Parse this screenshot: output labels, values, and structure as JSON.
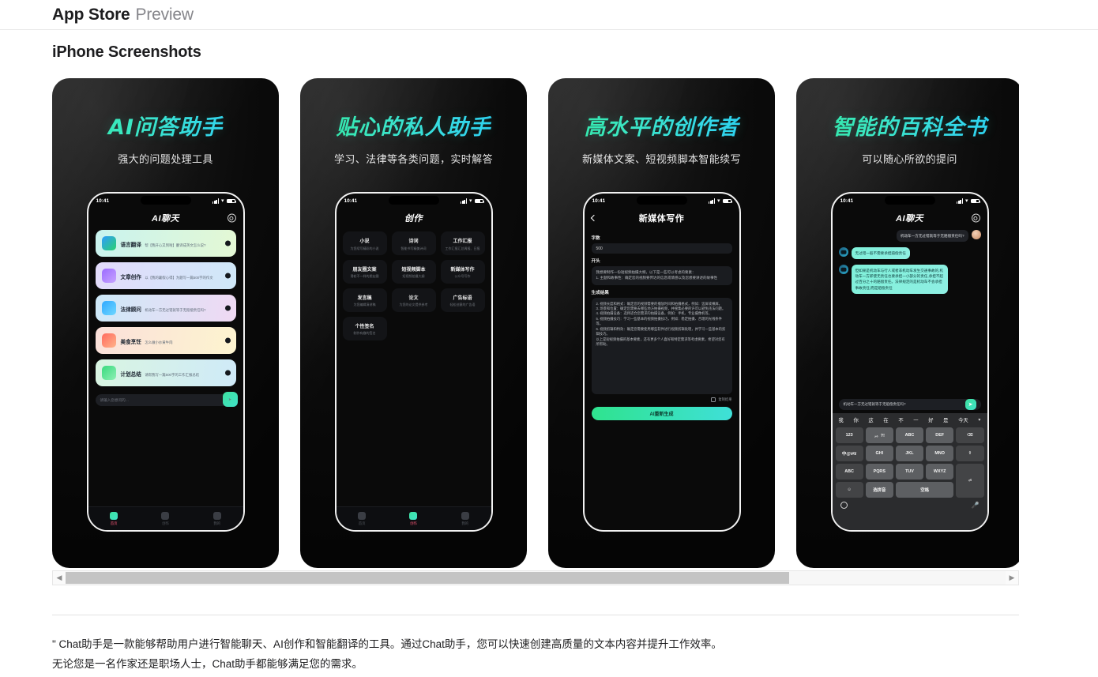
{
  "header": {
    "brand": "App Store",
    "section": "Preview"
  },
  "screenshots_heading": "iPhone Screenshots",
  "phone": {
    "time": "10:41",
    "wifi_icon": "wifi-icon",
    "battery_icon": "battery-icon",
    "signal_icon": "signal-bars-icon"
  },
  "panels": [
    {
      "title": "AI问答助手",
      "subtitle": "强大的问题处理工具",
      "app_title": "AI聊天",
      "gear_icon": "gear-icon",
      "items": [
        {
          "title": "语言翻译",
          "desc": "帮【我开心又到啦】翻译成英文怎么说?"
        },
        {
          "title": "文章创作",
          "desc": "以【我的暑假心得】为题写一篇500字的作文"
        },
        {
          "title": "法律顾问",
          "desc": "机动车一方无过错就等于无赔偿责任吗?"
        },
        {
          "title": "美食烹饪",
          "desc": "怎么做小炒黄牛肉"
        },
        {
          "title": "计划总结",
          "desc": "请帮我写一篇500字的工作汇报总结"
        }
      ],
      "input_placeholder": "请输入您想问的…",
      "send_icon": "send-icon",
      "tabs": [
        {
          "label": "首页",
          "icon": "home-icon",
          "active": true
        },
        {
          "label": "创作",
          "icon": "create-icon",
          "active": false
        },
        {
          "label": "我的",
          "icon": "profile-icon",
          "active": false
        }
      ]
    },
    {
      "title": "贴心的私人助手",
      "subtitle": "学习、法律等各类问题，实时解答",
      "app_title": "创作",
      "grid": [
        {
          "title": "小说",
          "desc": "为您续写精彩的小说"
        },
        {
          "title": "诗词",
          "desc": "智能书写精美诗词"
        },
        {
          "title": "工作汇报",
          "desc": "工作汇报汇总周报、日报"
        },
        {
          "title": "朋友圈文案",
          "desc": "滑轮不一样的朋友圈"
        },
        {
          "title": "短视频脚本",
          "desc": "短视频拍摄大纲"
        },
        {
          "title": "新媒体写作",
          "desc": "公众号写作"
        },
        {
          "title": "发言稿",
          "desc": "为您编辑演讲稿"
        },
        {
          "title": "论文",
          "desc": "为您的论文提供参考"
        },
        {
          "title": "广告标语",
          "desc": "轻松创意的广告语"
        },
        {
          "title": "个性签名",
          "desc": "制作有趣的签名"
        }
      ],
      "tabs": [
        {
          "label": "首页",
          "icon": "home-icon",
          "active": false
        },
        {
          "label": "创作",
          "icon": "create-icon",
          "active": true
        },
        {
          "label": "我的",
          "icon": "profile-icon",
          "active": false
        }
      ]
    },
    {
      "title": "高水平的创作者",
      "subtitle": "新媒体文案、短视频脚本智能续写",
      "app_title": "新媒体写作",
      "back_icon": "chevron-left-icon",
      "word_count_label": "字数",
      "word_count_value": "500",
      "opening_label": "开头",
      "opening_text": "我想要制作一份短视频拍摄大纲，以下是一些可以考虑的要素：\n1. 主题和故事性：确定您的视频要传达的信息或情感以及您想要讲述的故事性",
      "result_label": "生成结果",
      "result_text": "2. 视频长度和格式：确定您的视频需要的播放时间和拍摄格式，例如：竖屏或横屏。\n3. 场景和位置：确定您需要去哪些地方拍摄视频，并搜集必要的许可以避免违法问题。\n4. 视频拍摄设备：选择适合您需求的拍摄设备，例如：手机、专业摄像机等。\n5. 视频拍摄技巧：学习一些基本的视频拍摄技巧，例如：稳定拍摄、合理的光线条件等。\n6. 视频剪辑和特效：确定您需要使用哪些软件进行视频剪辑处理，并学习一些基本的剪辑技巧。\n以上是短视频拍摄的基本要素，还有更多个人喜好和特定需求等考虑要素，希望对您有所帮助。",
      "copy_label": "复制结果",
      "copy_icon": "copy-icon",
      "regenerate_button": "AI重新生成"
    },
    {
      "title": "智能的百科全书",
      "subtitle": "可以随心所欲的提问",
      "app_title": "AI聊天",
      "gear_icon": "gear-icon",
      "messages": [
        {
          "from": "user",
          "text": "机动车一方无过错就等于无赔偿责任吗?"
        },
        {
          "from": "ai",
          "text": "无过错一般不需要承担赔偿责任"
        },
        {
          "from": "ai",
          "text": "但如果是机动车与行人或者非机动车发生交通事故的,机动车一方即使无责任也要承担一小部分的责任,承担不超过百分之十的赔偿责任。法律规定的是机动车不会承担事故责任,而是赔偿责任"
        }
      ],
      "input_value": "机动车一方无过错就等于无赔偿责任吗?",
      "send_icon": "send-icon",
      "keyboard": {
        "suggestions": [
          "我",
          "你",
          "这",
          "在",
          "不",
          "一",
          "好",
          "是",
          "今天"
        ],
        "chevron_icon": "chevron-down-icon",
        "keys": [
          "123",
          "，。?!",
          "ABC",
          "DEF",
          "delete-icon",
          "中@\\#¥",
          "GHI",
          "JKL",
          "MNO",
          "shift-icon",
          "ABC",
          "PQRS",
          "TUV",
          "WXYZ",
          "return-icon",
          "emoji-icon",
          "选拼音",
          "空格"
        ],
        "globe_icon": "globe-icon",
        "mic_icon": "microphone-icon"
      }
    }
  ],
  "scrollbar": {
    "left_arrow_icon": "chevron-left-icon",
    "right_arrow_icon": "chevron-right-icon",
    "thumb_percent": 77
  },
  "description": "\" Chat助手是一款能够帮助用户进行智能聊天、AI创作和智能翻译的工具。通过Chat助手，您可以快速创建高质量的文本内容并提升工作效率。无论您是一名作家还是职场人士，Chat助手都能够满足您的需求。"
}
